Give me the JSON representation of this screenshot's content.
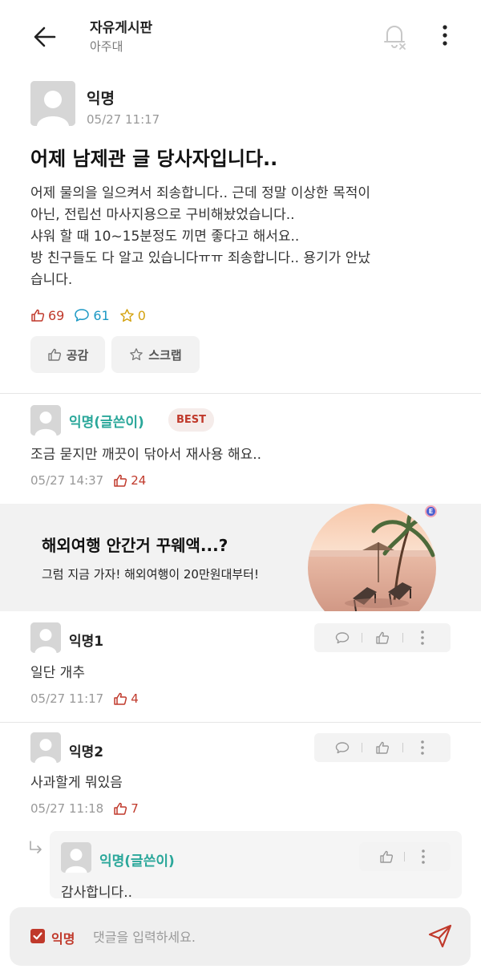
{
  "header": {
    "title": "자유게시판",
    "subtitle": "아주대"
  },
  "post": {
    "author": "익명",
    "time": "05/27 11:17",
    "title": "어제 남제관 글 당사자입니다..",
    "body_lines": [
      "어제 물의을 일으켜서 죄송합니다.. 근데 정말 이상한 목적이",
      "아닌, 전립선 마사지용으로 구비해놨었습니다..",
      "샤워 할 때 10~15분정도 끼면 좋다고 해서요..",
      "방 친구들도 다 알고 있습니다ㅠㅠ 죄송합니다.. 용기가 안났",
      "습니다."
    ],
    "likes": "69",
    "comments": "61",
    "scraps": "0",
    "like_button": "공감",
    "scrap_button": "스크랩"
  },
  "comments": [
    {
      "author": "익명(글쓴이)",
      "badge": "BEST",
      "text": "조금 묻지만 깨끗이 닦아서 재사용 해요..",
      "time": "05/27 14:37",
      "likes": "24"
    },
    {
      "author": "익명1",
      "text": "일단 개추",
      "time": "05/27 11:17",
      "likes": "4"
    },
    {
      "author": "익명2",
      "text": "사과할게 뭐있음",
      "time": "05/27 11:18",
      "likes": "7"
    }
  ],
  "reply": {
    "author": "익명(글쓴이)",
    "text": "감사합니다.."
  },
  "ad": {
    "title": "해외여행 안간거 꾸웨액...?",
    "subtitle": "그럼 지금 가자! 해외여행이 20만원대부터!",
    "badge": "E"
  },
  "input_bar": {
    "anon_label": "익명",
    "anon_checked": true,
    "placeholder": "댓글을 입력하세요.",
    "value": ""
  },
  "colors": {
    "accent_red": "#c0392b",
    "author_teal": "#2aa79a",
    "comment_blue": "#1b98c4",
    "scrap_yellow": "#d4a20f"
  },
  "icons": {
    "back": "arrow-left-icon",
    "bell": "bell-off-icon",
    "more": "more-vertical-icon",
    "like": "thumbs-up-icon",
    "comment": "speech-bubble-icon",
    "scrap": "star-icon",
    "send": "paper-plane-icon"
  }
}
